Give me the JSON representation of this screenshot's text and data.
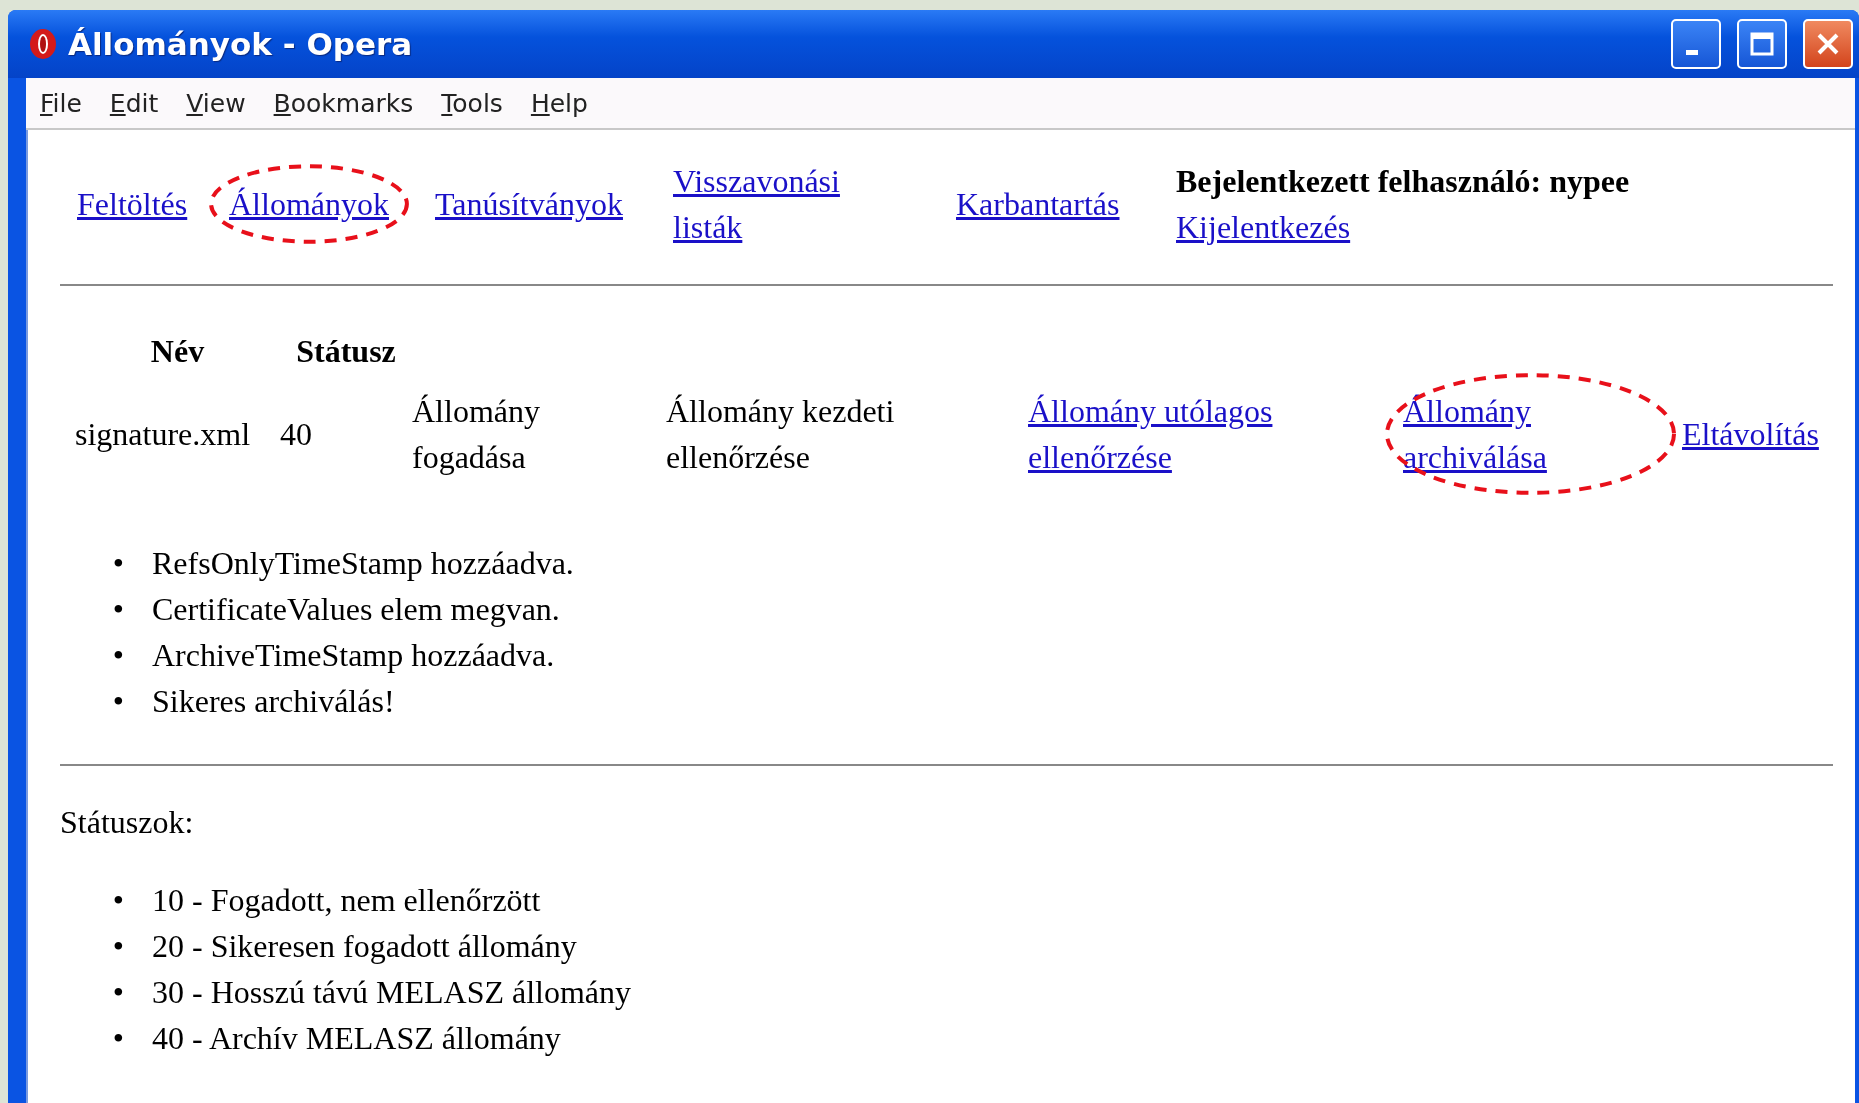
{
  "window": {
    "title": "Állományok - Opera"
  },
  "menu": [
    "File",
    "Edit",
    "View",
    "Bookmarks",
    "Tools",
    "Help"
  ],
  "nav": [
    {
      "label": "Feltöltés",
      "circled": false
    },
    {
      "label": "Állományok",
      "circled": true
    },
    {
      "label": "Tanúsítványok",
      "circled": false
    },
    {
      "label": "Visszavonási listák",
      "circled": false
    },
    {
      "label": "Karbantartás",
      "circled": false
    }
  ],
  "user": {
    "text": "Bejelentkezett felhasználó: nypee",
    "logout": "Kijelentkezés"
  },
  "table": {
    "columns": [
      "Név",
      "Státusz"
    ],
    "rows": [
      {
        "cells": [
          {
            "kind": "text",
            "text": "signature.xml",
            "circled": false
          },
          {
            "kind": "text",
            "text": "40",
            "circled": false
          },
          {
            "kind": "text",
            "text": "Állomány fogadása",
            "circled": false
          },
          {
            "kind": "text",
            "text": "Állomány kezdeti ellenőrzése",
            "circled": false
          },
          {
            "kind": "link",
            "text": "Állomány utólagos ellenőrzése",
            "circled": false
          },
          {
            "kind": "link",
            "text": "Állomány archiválása",
            "circled": true
          },
          {
            "kind": "link",
            "text": "Eltávolítás",
            "circled": false
          }
        ]
      }
    ]
  },
  "messages": [
    {
      "marker": "•",
      "text": "RefsOnlyTimeStamp hozzáadva."
    },
    {
      "marker": "•",
      "text": "CertificateValues elem megvan."
    },
    {
      "marker": "•",
      "text": "ArchiveTimeStamp hozzáadva."
    },
    {
      "marker": "•",
      "text": "Sikeres archiválás!"
    }
  ],
  "statuses_label": "Státuszok:",
  "statuses": [
    {
      "marker": "•",
      "text": "10 - Fogadott, nem ellenőrzött"
    },
    {
      "marker": "•",
      "text": "20 - Sikeresen fogadott állomány"
    },
    {
      "marker": "•",
      "text": "30 - Hosszú távú MELASZ állomány"
    },
    {
      "marker": "•",
      "text": "40 - Archív MELASZ állomány"
    }
  ]
}
